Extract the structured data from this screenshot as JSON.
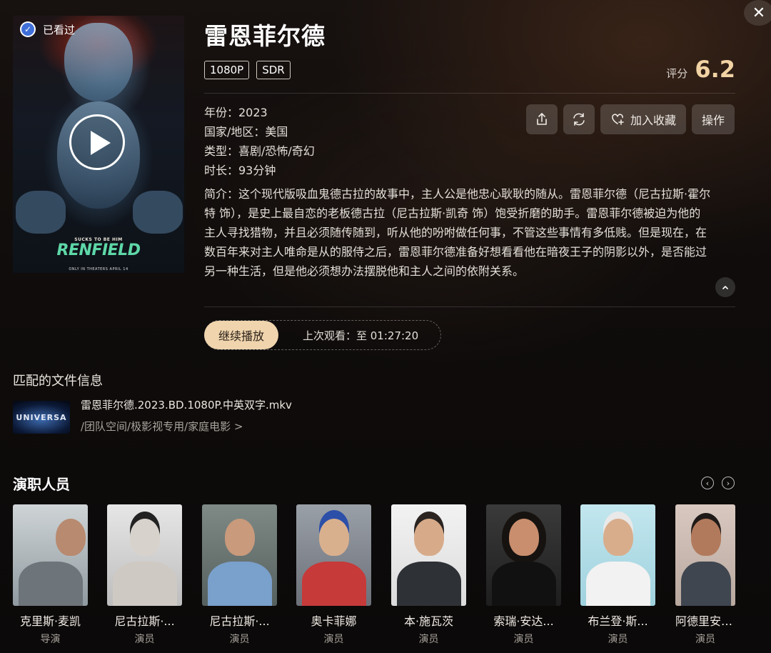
{
  "poster": {
    "watched_label": "已看过",
    "tagline": "SUCKS TO BE HIM",
    "logo_text": "RENFIELD",
    "release_text": "ONLY IN THEATERS APRIL 14"
  },
  "title": "雷恩菲尔德",
  "badges": [
    "1080P",
    "SDR"
  ],
  "rating": {
    "label": "评分",
    "value": "6.2"
  },
  "meta": {
    "year": "年份：2023",
    "region": "国家/地区：美国",
    "genre": "类型：喜剧/恐怖/奇幻",
    "duration": "时长：93分钟"
  },
  "actions": {
    "favorite_label": "加入收藏",
    "operate_label": "操作"
  },
  "description": "简介：这个现代版吸血鬼德古拉的故事中，主人公是他忠心耿耿的随从。雷恩菲尔德（尼古拉斯·霍尔特 饰），是史上最自恋的老板德古拉（尼古拉斯·凯奇 饰）饱受折磨的助手。雷恩菲尔德被迫为他的主人寻找猎物，并且必须随传随到，听从他的吩咐做任何事，不管这些事情有多低贱。但是现在，在数百年来对主人唯命是从的服侍之后，雷恩菲尔德准备好想看看他在暗夜王子的阴影以外，是否能过另一种生活，但是他必须想办法摆脱他和主人之间的依附关系。",
  "resume": {
    "button_label": "继续播放",
    "info": "上次观看：至 01:27:20"
  },
  "file_section": {
    "title": "匹配的文件信息",
    "thumb_text": "UNIVERSA",
    "file_name": "雷恩菲尔德.2023.BD.1080P.中英双字.mkv",
    "file_path": "/团队空间/极影视专用/家庭电影 >"
  },
  "cast_section": {
    "title": "演职人员",
    "members": [
      {
        "name": "克里斯·麦凯",
        "role": "导演"
      },
      {
        "name": "尼古拉斯·...",
        "role": "演员"
      },
      {
        "name": "尼古拉斯·...",
        "role": "演员"
      },
      {
        "name": "奥卡菲娜",
        "role": "演员"
      },
      {
        "name": "本·施瓦茨",
        "role": "演员"
      },
      {
        "name": "索瑞·安达...",
        "role": "演员"
      },
      {
        "name": "布兰登·斯...",
        "role": "演员"
      },
      {
        "name": "阿德里安·...",
        "role": "演员"
      }
    ]
  },
  "colors": {
    "accent": "#efd4ad",
    "rating": "#f1d3a4",
    "watched_blue": "#3f6fd8"
  },
  "icons": [
    "check-icon",
    "play-icon",
    "close-icon",
    "share-icon",
    "refresh-icon",
    "heart-plus-icon",
    "chevron-up-icon",
    "chevron-left-icon",
    "chevron-right-icon"
  ]
}
